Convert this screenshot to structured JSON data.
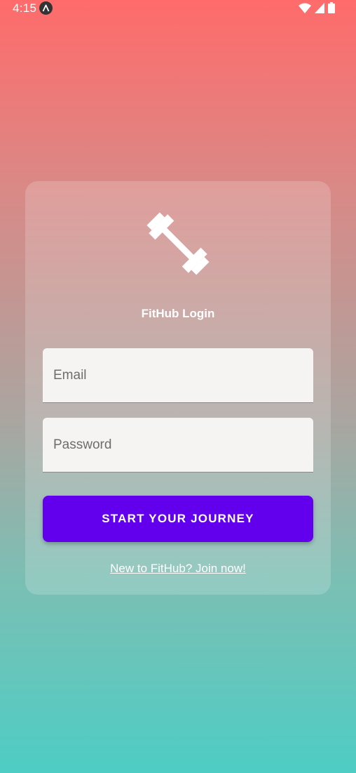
{
  "status_bar": {
    "time": "4:15"
  },
  "login": {
    "title": "FitHub Login",
    "email_placeholder": "Email",
    "password_placeholder": "Password",
    "submit_label": "START YOUR JOURNEY",
    "join_link": "New to FitHub? Join now!"
  },
  "colors": {
    "gradient_top": "#ff6b6b",
    "gradient_bottom": "#4ecdc4",
    "button": "#6200ee"
  },
  "icons": {
    "logo": "barbell-icon",
    "wifi": "wifi-icon",
    "signal": "signal-icon",
    "battery": "battery-icon",
    "app_status": "app-status-icon"
  }
}
